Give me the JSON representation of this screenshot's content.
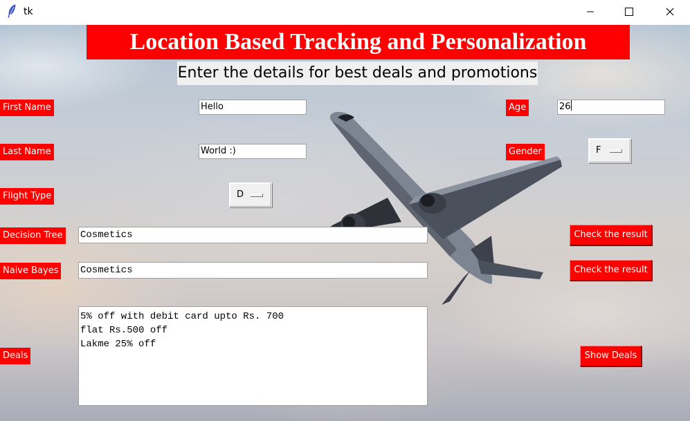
{
  "window": {
    "title": "tk"
  },
  "header": {
    "title": "Location Based Tracking and Personalization",
    "subtitle": "Enter the details for best deals and promotions"
  },
  "form": {
    "first_name_label": "First Name",
    "first_name_value": "Hello",
    "last_name_label": "Last Name",
    "last_name_value": "World :)",
    "age_label": "Age",
    "age_value": "26",
    "gender_label": "Gender",
    "gender_value": "F",
    "flight_type_label": "Flight Type",
    "flight_type_value": "D"
  },
  "results": {
    "decision_tree_label": "Decision Tree",
    "decision_tree_value": "Cosmetics",
    "naive_bayes_label": "Naive Bayes",
    "naive_bayes_value": "Cosmetics",
    "check_button_label": "Check the result"
  },
  "deals": {
    "label": "Deals",
    "button_label": "Show Deals",
    "lines": [
      "5% off with debit card upto Rs. 700",
      "flat Rs.500 off",
      "Lakme 25% off"
    ]
  },
  "colors": {
    "accent": "#ff0000",
    "label_text": "#ffffff"
  },
  "icons": {
    "app": "feather-icon",
    "minimize": "minimize-icon",
    "maximize": "maximize-icon",
    "close": "close-icon"
  }
}
